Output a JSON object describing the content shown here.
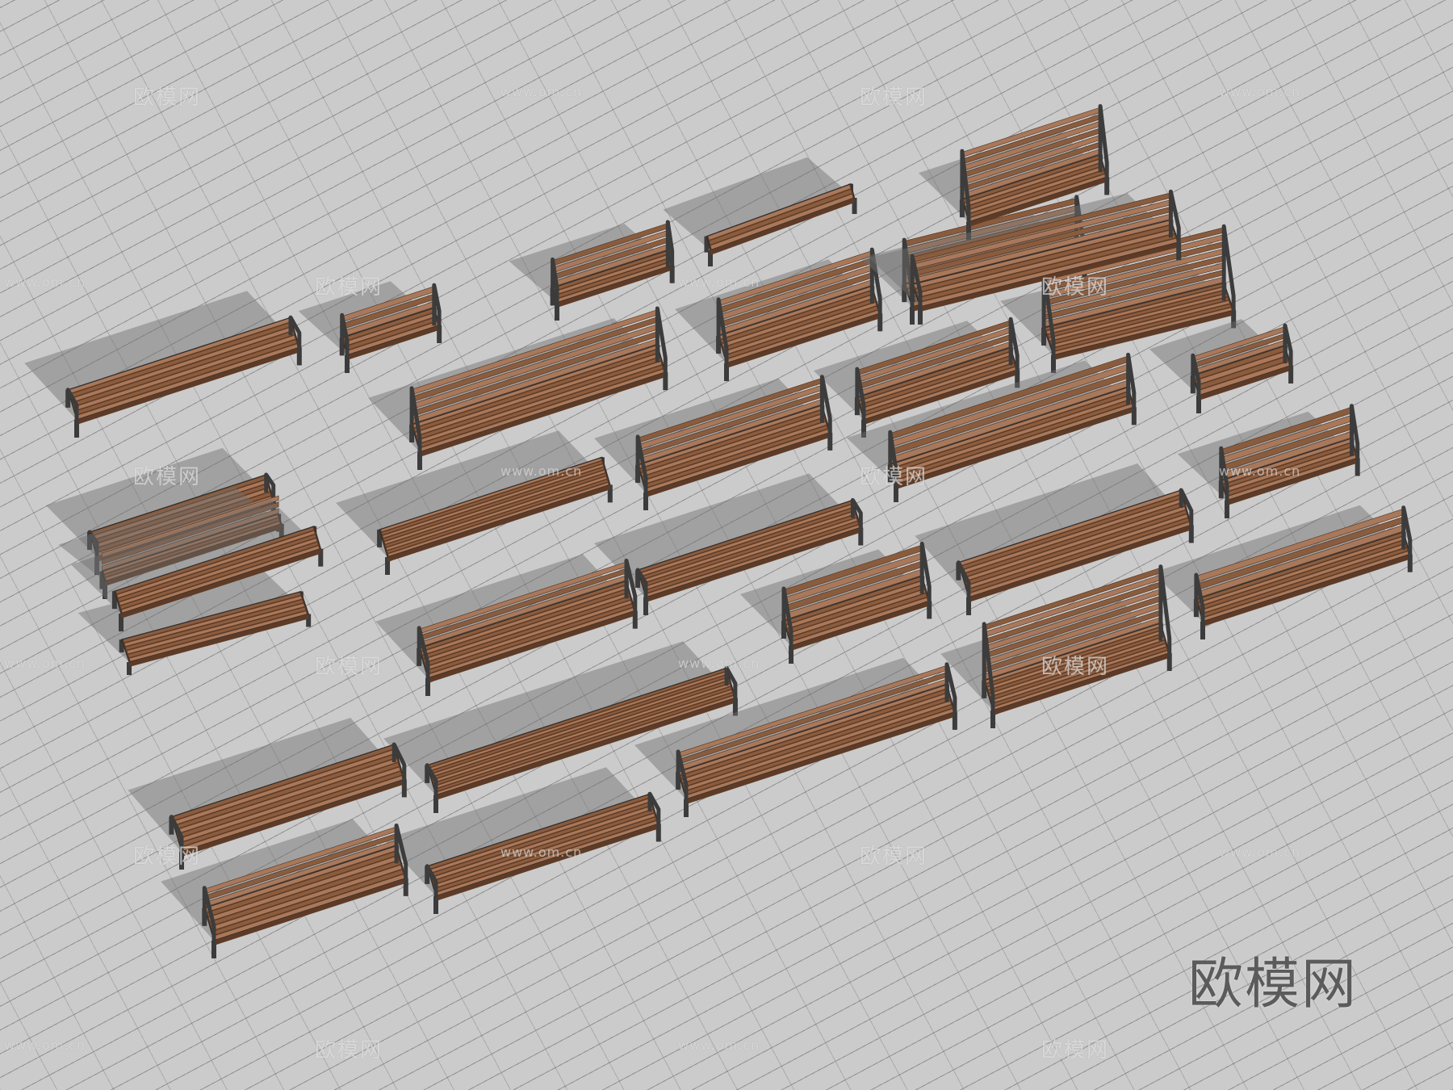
{
  "watermark": {
    "text": "欧模网",
    "url": "www.om.cn"
  },
  "brand": {
    "logo_text": "欧模网"
  },
  "colors": {
    "ground": "#cbcbcb",
    "wood": "#8a5c3e",
    "wood_light": "#a9785a",
    "wood_dark": "#5e3b26",
    "metal": "#3c3c3c",
    "shadow": "rgba(110,110,110,0.45)"
  }
}
